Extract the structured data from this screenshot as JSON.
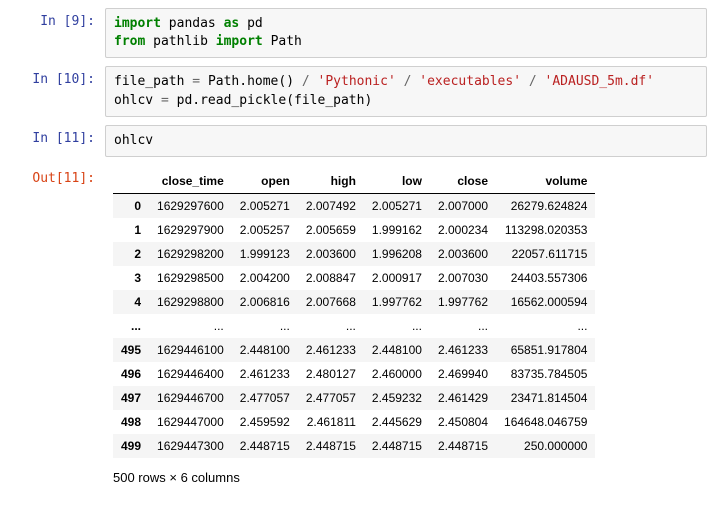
{
  "cells": {
    "c0": {
      "prompt": "In [9]:"
    },
    "c1": {
      "prompt": "In [10]:"
    },
    "c2": {
      "prompt": "In [11]:",
      "out_prompt": "Out[11]:",
      "code": "ohlcv"
    }
  },
  "code0": {
    "kw_import": "import",
    "pandas": "pandas",
    "kw_as": "as",
    "pd": "pd",
    "kw_from": "from",
    "pathlib": "pathlib",
    "kw_import2": "import",
    "Path": "Path"
  },
  "code1": {
    "file_path": "file_path",
    "eq": "=",
    "Path_home": "Path.home()",
    "slash": "/",
    "s1": "'Pythonic'",
    "s2": "'executables'",
    "s3": "'ADAUSD_5m.df'",
    "ohlcv": "ohlcv",
    "read": "pd.read_pickle(file_path)"
  },
  "table": {
    "columns": [
      "close_time",
      "open",
      "high",
      "low",
      "close",
      "volume"
    ],
    "rows": [
      {
        "idx": "0",
        "v": [
          "1629297600",
          "2.005271",
          "2.007492",
          "2.005271",
          "2.007000",
          "26279.624824"
        ]
      },
      {
        "idx": "1",
        "v": [
          "1629297900",
          "2.005257",
          "2.005659",
          "1.999162",
          "2.000234",
          "113298.020353"
        ]
      },
      {
        "idx": "2",
        "v": [
          "1629298200",
          "1.999123",
          "2.003600",
          "1.996208",
          "2.003600",
          "22057.611715"
        ]
      },
      {
        "idx": "3",
        "v": [
          "1629298500",
          "2.004200",
          "2.008847",
          "2.000917",
          "2.007030",
          "24403.557306"
        ]
      },
      {
        "idx": "4",
        "v": [
          "1629298800",
          "2.006816",
          "2.007668",
          "1.997762",
          "1.997762",
          "16562.000594"
        ]
      },
      {
        "idx": "...",
        "v": [
          "...",
          "...",
          "...",
          "...",
          "...",
          "..."
        ]
      },
      {
        "idx": "495",
        "v": [
          "1629446100",
          "2.448100",
          "2.461233",
          "2.448100",
          "2.461233",
          "65851.917804"
        ]
      },
      {
        "idx": "496",
        "v": [
          "1629446400",
          "2.461233",
          "2.480127",
          "2.460000",
          "2.469940",
          "83735.784505"
        ]
      },
      {
        "idx": "497",
        "v": [
          "1629446700",
          "2.477057",
          "2.477057",
          "2.459232",
          "2.461429",
          "23471.814504"
        ]
      },
      {
        "idx": "498",
        "v": [
          "1629447000",
          "2.459592",
          "2.461811",
          "2.445629",
          "2.450804",
          "164648.046759"
        ]
      },
      {
        "idx": "499",
        "v": [
          "1629447300",
          "2.448715",
          "2.448715",
          "2.448715",
          "2.448715",
          "250.000000"
        ]
      }
    ],
    "summary": "500 rows × 6 columns"
  }
}
